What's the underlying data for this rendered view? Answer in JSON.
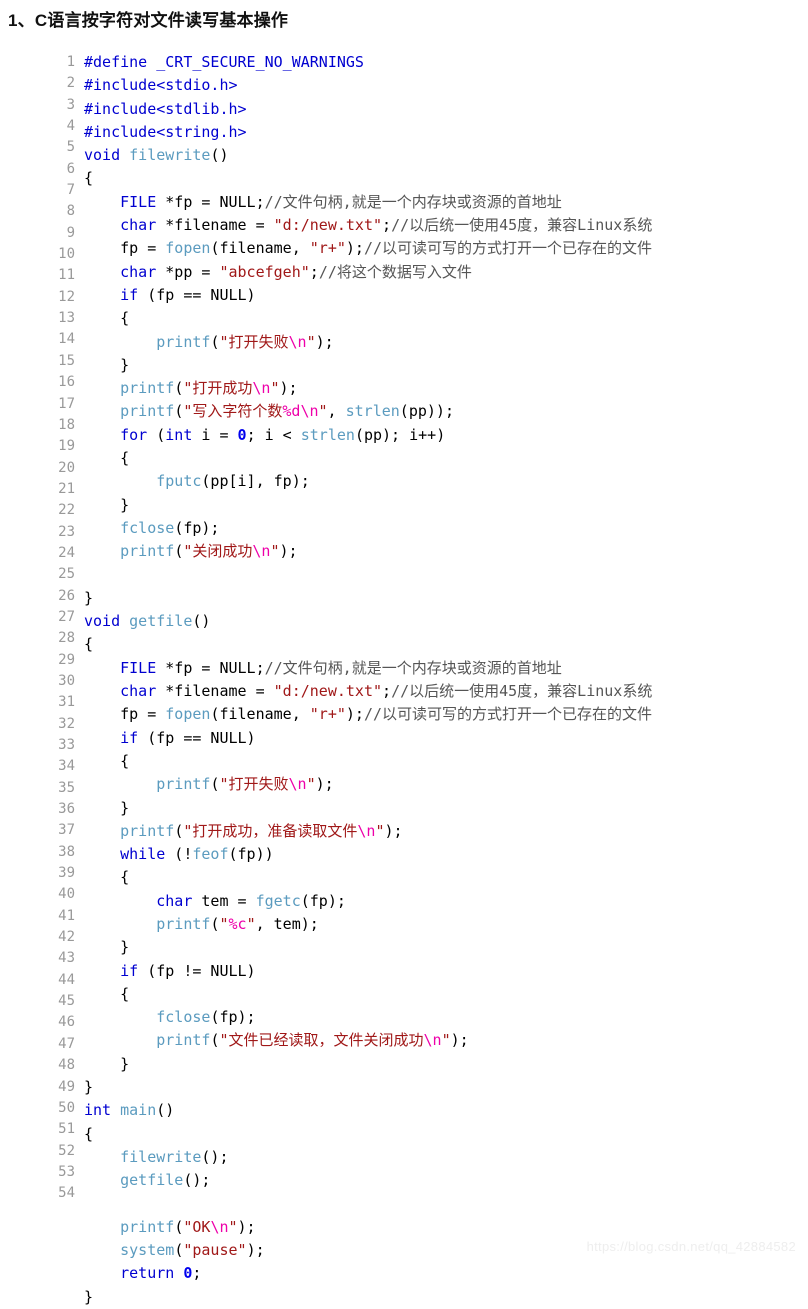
{
  "heading": "1、C语言按字符对文件读写基本操作",
  "watermark": "https://blog.csdn.net/qq_42884582",
  "colors": {
    "heading": "#111111",
    "gutter": "#999999",
    "keyword": "#0000d0",
    "preprocessor": "#0000d0",
    "function": "#5b9bbf",
    "string": "#a01818",
    "escape": "#ee00aa",
    "number": "#0000ee",
    "comment": "#555555",
    "plain": "#000000",
    "watermark": "#eeeeee",
    "background": "#ffffff"
  },
  "code": {
    "language": "c",
    "first_line_number": 1,
    "last_line_number": 54,
    "line_numbers": [
      1,
      2,
      3,
      4,
      5,
      6,
      7,
      8,
      9,
      10,
      11,
      12,
      13,
      14,
      15,
      16,
      17,
      18,
      19,
      20,
      21,
      22,
      23,
      24,
      25,
      26,
      27,
      28,
      29,
      30,
      31,
      32,
      33,
      34,
      35,
      36,
      37,
      38,
      39,
      40,
      41,
      42,
      43,
      44,
      45,
      46,
      47,
      48,
      49,
      50,
      51,
      52,
      53,
      54
    ],
    "lines": [
      "#define _CRT_SECURE_NO_WARNINGS",
      "#include<stdio.h>",
      "#include<stdlib.h>",
      "#include<string.h>",
      "void filewrite()",
      "{",
      "    FILE *fp = NULL;//文件句柄,就是一个内存块或资源的首地址",
      "    char *filename = \"d:/new.txt\";//以后统一使用45度，兼容Linux系统",
      "    fp = fopen(filename, \"r+\");//以可读可写的方式打开一个已存在的文件",
      "    char *pp = \"abcefgeh\";//将这个数据写入文件",
      "    if (fp == NULL)",
      "    {",
      "        printf(\"打开失败\\n\");",
      "    }",
      "    printf(\"打开成功\\n\");",
      "    printf(\"写入字符个数%d\\n\", strlen(pp));",
      "    for (int i = 0; i < strlen(pp); i++)",
      "    {",
      "        fputc(pp[i], fp);",
      "    }",
      "    fclose(fp);",
      "    printf(\"关闭成功\\n\");",
      "",
      "}",
      "void getfile()",
      "{",
      "    FILE *fp = NULL;//文件句柄,就是一个内存块或资源的首地址",
      "    char *filename = \"d:/new.txt\";//以后统一使用45度，兼容Linux系统",
      "    fp = fopen(filename, \"r+\");//以可读可写的方式打开一个已存在的文件",
      "    if (fp == NULL)",
      "    {",
      "        printf(\"打开失败\\n\");",
      "    }",
      "    printf(\"打开成功，准备读取文件\\n\");",
      "    while (!feof(fp))",
      "    {",
      "        char tem = fgetc(fp);",
      "        printf(\"%c\", tem);",
      "    }",
      "    if (fp != NULL)",
      "    {",
      "        fclose(fp);",
      "        printf(\"文件已经读取，文件关闭成功\\n\");",
      "    }",
      "}",
      "int main()",
      "{",
      "    filewrite();",
      "    getfile();",
      "",
      "    printf(\"OK\\n\");",
      "    system(\"pause\");",
      "    return 0;",
      "}"
    ],
    "tokens": [
      [
        [
          "tok-pre",
          "#define _CRT_SECURE_NO_WARNINGS"
        ]
      ],
      [
        [
          "tok-pre",
          "#include<stdio.h>"
        ]
      ],
      [
        [
          "tok-pre",
          "#include<stdlib.h>"
        ]
      ],
      [
        [
          "tok-pre",
          "#include<string.h>"
        ]
      ],
      [
        [
          "tok-kw",
          "void"
        ],
        [
          "tok-pun",
          " "
        ],
        [
          "tok-fn",
          "filewrite"
        ],
        [
          "tok-pun",
          "()"
        ]
      ],
      [
        [
          "tok-pun",
          "{"
        ]
      ],
      [
        [
          "tok-pun",
          "    "
        ],
        [
          "tok-type",
          "FILE"
        ],
        [
          "tok-pun",
          " *fp = NULL;"
        ],
        [
          "tok-cmt",
          "//文件句柄,就是一个内存块或资源的首地址"
        ]
      ],
      [
        [
          "tok-pun",
          "    "
        ],
        [
          "tok-kw",
          "char"
        ],
        [
          "tok-pun",
          " *filename = "
        ],
        [
          "tok-str",
          "\"d:/new.txt\""
        ],
        [
          "tok-pun",
          ";"
        ],
        [
          "tok-cmt",
          "//以后统一使用45度，兼容Linux系统"
        ]
      ],
      [
        [
          "tok-pun",
          "    fp = "
        ],
        [
          "tok-fn",
          "fopen"
        ],
        [
          "tok-pun",
          "(filename, "
        ],
        [
          "tok-str",
          "\"r+\""
        ],
        [
          "tok-pun",
          ");"
        ],
        [
          "tok-cmt",
          "//以可读可写的方式打开一个已存在的文件"
        ]
      ],
      [
        [
          "tok-pun",
          "    "
        ],
        [
          "tok-kw",
          "char"
        ],
        [
          "tok-pun",
          " *pp = "
        ],
        [
          "tok-str",
          "\"abcefgeh\""
        ],
        [
          "tok-pun",
          ";"
        ],
        [
          "tok-cmt",
          "//将这个数据写入文件"
        ]
      ],
      [
        [
          "tok-pun",
          "    "
        ],
        [
          "tok-kw",
          "if"
        ],
        [
          "tok-pun",
          " (fp == NULL)"
        ]
      ],
      [
        [
          "tok-pun",
          "    {"
        ]
      ],
      [
        [
          "tok-pun",
          "        "
        ],
        [
          "tok-fn",
          "printf"
        ],
        [
          "tok-pun",
          "("
        ],
        [
          "tok-str",
          "\"打开失败"
        ],
        [
          "tok-esc",
          "\\n"
        ],
        [
          "tok-str",
          "\""
        ],
        [
          "tok-pun",
          ");"
        ]
      ],
      [
        [
          "tok-pun",
          "    }"
        ]
      ],
      [
        [
          "tok-pun",
          "    "
        ],
        [
          "tok-fn",
          "printf"
        ],
        [
          "tok-pun",
          "("
        ],
        [
          "tok-str",
          "\"打开成功"
        ],
        [
          "tok-esc",
          "\\n"
        ],
        [
          "tok-str",
          "\""
        ],
        [
          "tok-pun",
          ");"
        ]
      ],
      [
        [
          "tok-pun",
          "    "
        ],
        [
          "tok-fn",
          "printf"
        ],
        [
          "tok-pun",
          "("
        ],
        [
          "tok-str",
          "\"写入字符个数"
        ],
        [
          "tok-esc",
          "%d\\n"
        ],
        [
          "tok-str",
          "\""
        ],
        [
          "tok-pun",
          ", "
        ],
        [
          "tok-fn",
          "strlen"
        ],
        [
          "tok-pun",
          "(pp));"
        ]
      ],
      [
        [
          "tok-pun",
          "    "
        ],
        [
          "tok-kw",
          "for"
        ],
        [
          "tok-pun",
          " ("
        ],
        [
          "tok-kw",
          "int"
        ],
        [
          "tok-pun",
          " i = "
        ],
        [
          "tok-num",
          "0"
        ],
        [
          "tok-pun",
          "; i < "
        ],
        [
          "tok-fn",
          "strlen"
        ],
        [
          "tok-pun",
          "(pp); i++)"
        ]
      ],
      [
        [
          "tok-pun",
          "    {"
        ]
      ],
      [
        [
          "tok-pun",
          "        "
        ],
        [
          "tok-fn",
          "fputc"
        ],
        [
          "tok-pun",
          "(pp[i], fp);"
        ]
      ],
      [
        [
          "tok-pun",
          "    }"
        ]
      ],
      [
        [
          "tok-pun",
          "    "
        ],
        [
          "tok-fn",
          "fclose"
        ],
        [
          "tok-pun",
          "(fp);"
        ]
      ],
      [
        [
          "tok-pun",
          "    "
        ],
        [
          "tok-fn",
          "printf"
        ],
        [
          "tok-pun",
          "("
        ],
        [
          "tok-str",
          "\"关闭成功"
        ],
        [
          "tok-esc",
          "\\n"
        ],
        [
          "tok-str",
          "\""
        ],
        [
          "tok-pun",
          ");"
        ]
      ],
      [
        [
          "tok-pun",
          ""
        ]
      ],
      [
        [
          "tok-pun",
          "}"
        ]
      ],
      [
        [
          "tok-kw",
          "void"
        ],
        [
          "tok-pun",
          " "
        ],
        [
          "tok-fn",
          "getfile"
        ],
        [
          "tok-pun",
          "()"
        ]
      ],
      [
        [
          "tok-pun",
          "{"
        ]
      ],
      [
        [
          "tok-pun",
          "    "
        ],
        [
          "tok-type",
          "FILE"
        ],
        [
          "tok-pun",
          " *fp = NULL;"
        ],
        [
          "tok-cmt",
          "//文件句柄,就是一个内存块或资源的首地址"
        ]
      ],
      [
        [
          "tok-pun",
          "    "
        ],
        [
          "tok-kw",
          "char"
        ],
        [
          "tok-pun",
          " *filename = "
        ],
        [
          "tok-str",
          "\"d:/new.txt\""
        ],
        [
          "tok-pun",
          ";"
        ],
        [
          "tok-cmt",
          "//以后统一使用45度，兼容Linux系统"
        ]
      ],
      [
        [
          "tok-pun",
          "    fp = "
        ],
        [
          "tok-fn",
          "fopen"
        ],
        [
          "tok-pun",
          "(filename, "
        ],
        [
          "tok-str",
          "\"r+\""
        ],
        [
          "tok-pun",
          ");"
        ],
        [
          "tok-cmt",
          "//以可读可写的方式打开一个已存在的文件"
        ]
      ],
      [
        [
          "tok-pun",
          "    "
        ],
        [
          "tok-kw",
          "if"
        ],
        [
          "tok-pun",
          " (fp == NULL)"
        ]
      ],
      [
        [
          "tok-pun",
          "    {"
        ]
      ],
      [
        [
          "tok-pun",
          "        "
        ],
        [
          "tok-fn",
          "printf"
        ],
        [
          "tok-pun",
          "("
        ],
        [
          "tok-str",
          "\"打开失败"
        ],
        [
          "tok-esc",
          "\\n"
        ],
        [
          "tok-str",
          "\""
        ],
        [
          "tok-pun",
          ");"
        ]
      ],
      [
        [
          "tok-pun",
          "    }"
        ]
      ],
      [
        [
          "tok-pun",
          "    "
        ],
        [
          "tok-fn",
          "printf"
        ],
        [
          "tok-pun",
          "("
        ],
        [
          "tok-str",
          "\"打开成功，准备读取文件"
        ],
        [
          "tok-esc",
          "\\n"
        ],
        [
          "tok-str",
          "\""
        ],
        [
          "tok-pun",
          ");"
        ]
      ],
      [
        [
          "tok-pun",
          "    "
        ],
        [
          "tok-kw",
          "while"
        ],
        [
          "tok-pun",
          " (!"
        ],
        [
          "tok-fn",
          "feof"
        ],
        [
          "tok-pun",
          "(fp))"
        ]
      ],
      [
        [
          "tok-pun",
          "    {"
        ]
      ],
      [
        [
          "tok-pun",
          "        "
        ],
        [
          "tok-kw",
          "char"
        ],
        [
          "tok-pun",
          " tem = "
        ],
        [
          "tok-fn",
          "fgetc"
        ],
        [
          "tok-pun",
          "(fp);"
        ]
      ],
      [
        [
          "tok-pun",
          "        "
        ],
        [
          "tok-fn",
          "printf"
        ],
        [
          "tok-pun",
          "("
        ],
        [
          "tok-str",
          "\""
        ],
        [
          "tok-esc",
          "%c"
        ],
        [
          "tok-str",
          "\""
        ],
        [
          "tok-pun",
          ", tem);"
        ]
      ],
      [
        [
          "tok-pun",
          "    }"
        ]
      ],
      [
        [
          "tok-pun",
          "    "
        ],
        [
          "tok-kw",
          "if"
        ],
        [
          "tok-pun",
          " (fp != NULL)"
        ]
      ],
      [
        [
          "tok-pun",
          "    {"
        ]
      ],
      [
        [
          "tok-pun",
          "        "
        ],
        [
          "tok-fn",
          "fclose"
        ],
        [
          "tok-pun",
          "(fp);"
        ]
      ],
      [
        [
          "tok-pun",
          "        "
        ],
        [
          "tok-fn",
          "printf"
        ],
        [
          "tok-pun",
          "("
        ],
        [
          "tok-str",
          "\"文件已经读取，文件关闭成功"
        ],
        [
          "tok-esc",
          "\\n"
        ],
        [
          "tok-str",
          "\""
        ],
        [
          "tok-pun",
          ");"
        ]
      ],
      [
        [
          "tok-pun",
          "    }"
        ]
      ],
      [
        [
          "tok-pun",
          "}"
        ]
      ],
      [
        [
          "tok-kw",
          "int"
        ],
        [
          "tok-pun",
          " "
        ],
        [
          "tok-fn",
          "main"
        ],
        [
          "tok-pun",
          "()"
        ]
      ],
      [
        [
          "tok-pun",
          "{"
        ]
      ],
      [
        [
          "tok-pun",
          "    "
        ],
        [
          "tok-fn",
          "filewrite"
        ],
        [
          "tok-pun",
          "();"
        ]
      ],
      [
        [
          "tok-pun",
          "    "
        ],
        [
          "tok-fn",
          "getfile"
        ],
        [
          "tok-pun",
          "();"
        ]
      ],
      [
        [
          "tok-pun",
          ""
        ]
      ],
      [
        [
          "tok-pun",
          "    "
        ],
        [
          "tok-fn",
          "printf"
        ],
        [
          "tok-pun",
          "("
        ],
        [
          "tok-str",
          "\"OK"
        ],
        [
          "tok-esc",
          "\\n"
        ],
        [
          "tok-str",
          "\""
        ],
        [
          "tok-pun",
          ");"
        ]
      ],
      [
        [
          "tok-pun",
          "    "
        ],
        [
          "tok-fn",
          "system"
        ],
        [
          "tok-pun",
          "("
        ],
        [
          "tok-str",
          "\"pause\""
        ],
        [
          "tok-pun",
          ");"
        ]
      ],
      [
        [
          "tok-pun",
          "    "
        ],
        [
          "tok-kw",
          "return"
        ],
        [
          "tok-pun",
          " "
        ],
        [
          "tok-num",
          "0"
        ],
        [
          "tok-pun",
          ";"
        ]
      ],
      [
        [
          "tok-pun",
          "}"
        ]
      ]
    ]
  }
}
